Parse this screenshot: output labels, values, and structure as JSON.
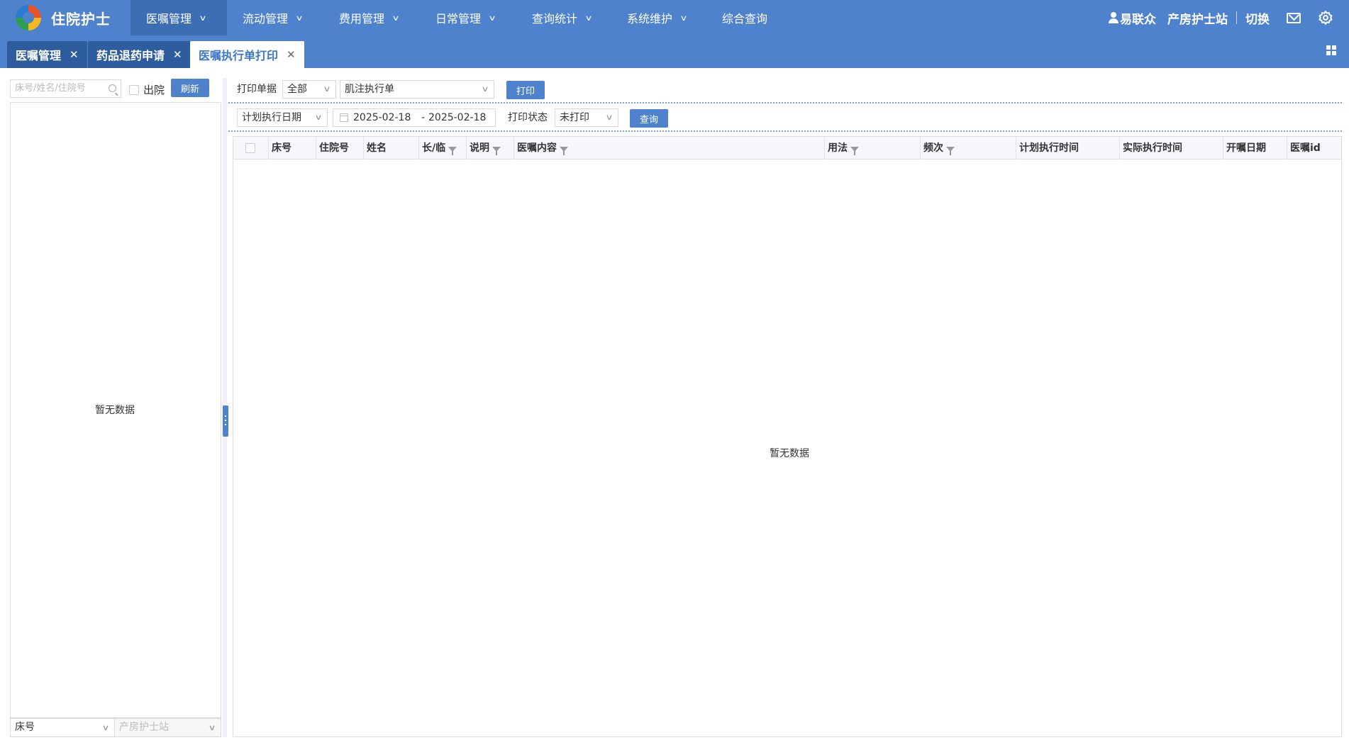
{
  "app": {
    "title": "住院护士"
  },
  "nav": {
    "items": [
      {
        "label": "医嘱管理",
        "active": true,
        "has_menu": true
      },
      {
        "label": "流动管理",
        "active": false,
        "has_menu": true
      },
      {
        "label": "费用管理",
        "active": false,
        "has_menu": true
      },
      {
        "label": "日常管理",
        "active": false,
        "has_menu": true
      },
      {
        "label": "查询统计",
        "active": false,
        "has_menu": true
      },
      {
        "label": "系统维护",
        "active": false,
        "has_menu": true
      },
      {
        "label": "综合查询",
        "active": false,
        "has_menu": false
      }
    ]
  },
  "header_right": {
    "user": "易联众",
    "station": "产房护士站",
    "switch": "切换"
  },
  "tabs": [
    {
      "label": "医嘱管理",
      "active": false
    },
    {
      "label": "药品退药申请",
      "active": false
    },
    {
      "label": "医嘱执行单打印",
      "active": true
    }
  ],
  "left": {
    "search_placeholder": "床号/姓名/住院号",
    "discharge_label": "出院",
    "refresh_label": "刷新",
    "empty_text": "暂无数据",
    "sort_value": "床号",
    "station_value": "产房护士站"
  },
  "filters": {
    "print_doc_label": "打印单据",
    "scope_value": "全部",
    "doc_type_value": "肌注执行单",
    "print_button": "打印",
    "date_type_value": "计划执行日期",
    "date_start": "2025-02-18",
    "date_sep": "-",
    "date_end": "2025-02-18",
    "print_status_label": "打印状态",
    "print_status_value": "未打印",
    "query_button": "查询"
  },
  "table": {
    "columns": [
      {
        "label": "",
        "filter": false
      },
      {
        "label": "床号",
        "filter": false
      },
      {
        "label": "住院号",
        "filter": false
      },
      {
        "label": "姓名",
        "filter": false
      },
      {
        "label": "长/临",
        "filter": true
      },
      {
        "label": "说明",
        "filter": true
      },
      {
        "label": "医嘱内容",
        "filter": true
      },
      {
        "label": "用法",
        "filter": true
      },
      {
        "label": "频次",
        "filter": true
      },
      {
        "label": "计划执行时间",
        "filter": false
      },
      {
        "label": "实际执行时间",
        "filter": false
      },
      {
        "label": "开嘱日期",
        "filter": false
      },
      {
        "label": "医嘱id",
        "filter": false
      }
    ],
    "empty_text": "暂无数据"
  },
  "colors": {
    "primary": "#4e82cc",
    "nav_active": "#3d6db3",
    "tab_dark": "#2e5d9f"
  }
}
